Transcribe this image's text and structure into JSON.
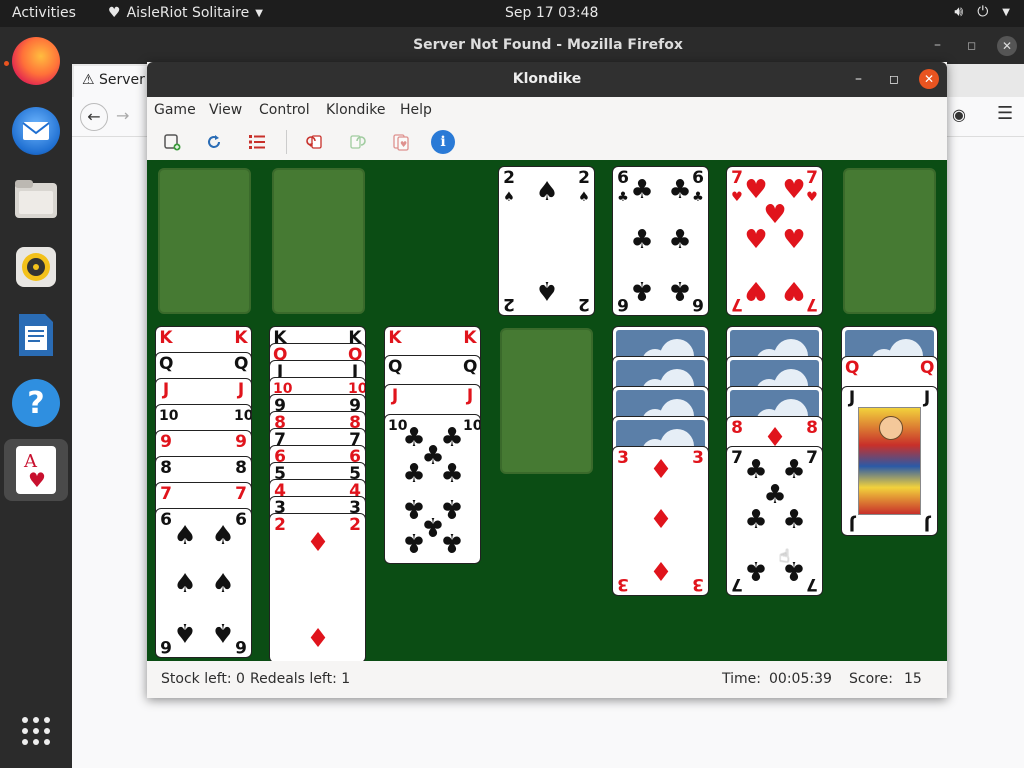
{
  "topbar": {
    "activities": "Activities",
    "app_name": "AisleRiot Solitaire",
    "clock": "Sep 17  03:48"
  },
  "dock": {
    "items": [
      "firefox-icon",
      "thunderbird-icon",
      "files-icon",
      "rhythmbox-icon",
      "writer-icon",
      "help-icon",
      "aisleriot-icon",
      "app-grid-icon"
    ]
  },
  "firefox": {
    "title": "Server Not Found - Mozilla Firefox",
    "tab_label": "Server"
  },
  "window": {
    "title": "Klondike"
  },
  "menu": {
    "game": "Game",
    "view": "View",
    "control": "Control",
    "klondike": "Klondike",
    "help": "Help"
  },
  "toolbar": [
    "new-game-icon",
    "restart-icon",
    "select-game-icon",
    "undo-icon",
    "redo-icon",
    "hint-icon",
    "info-icon"
  ],
  "status": {
    "stock_left": "Stock left: 0",
    "redeals_left": "Redeals left: 1",
    "time_label": "Time:",
    "time_value": "00:05:39",
    "score_label": "Score:",
    "score_value": "15"
  },
  "board": {
    "stock": "empty",
    "waste": "empty",
    "foundations": [
      "2♠",
      "6♣",
      "7♥",
      "empty"
    ],
    "tableau": [
      [
        "K♥",
        "Q♠",
        "J♥",
        "10♠",
        "9♥",
        "8♣",
        "7♥",
        "6♠"
      ],
      [
        "K♠",
        "Q♥",
        "J♠",
        "10♥",
        "9♠",
        "8♥",
        "7♠",
        "6♥",
        "5♠",
        "4♥",
        "3♠",
        "2♦"
      ],
      [
        "K♥",
        "Q♣",
        "J♦",
        "10♣"
      ],
      [
        "empty"
      ],
      [
        "face-down",
        "face-down",
        "face-down",
        "face-down",
        "3♦"
      ],
      [
        "face-down",
        "face-down",
        "face-down",
        "8♦",
        "7♣"
      ],
      [
        "face-down",
        "Q♥",
        "J♣"
      ]
    ]
  },
  "colors": {
    "felt": "#0b4d14",
    "slot": "#467a33",
    "card_red": "#e0141c",
    "card_back": "#5b7fa8",
    "close_button": "#e95420"
  }
}
